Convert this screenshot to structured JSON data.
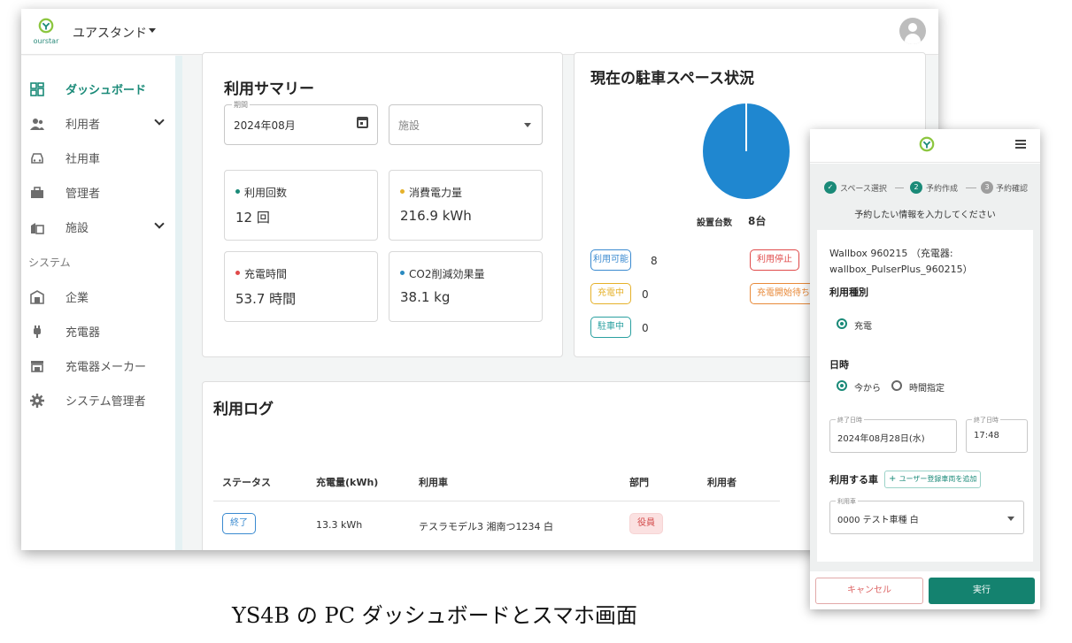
{
  "desktop": {
    "logo_text": "ourstar",
    "org_name": "ユアスタンド",
    "sidebar": {
      "items": [
        {
          "label": "ダッシュボード",
          "icon": "dashboard-icon",
          "active": true
        },
        {
          "label": "利用者",
          "icon": "users-icon",
          "expandable": true
        },
        {
          "label": "社用車",
          "icon": "car-icon"
        },
        {
          "label": "管理者",
          "icon": "briefcase-icon"
        },
        {
          "label": "施設",
          "icon": "facility-icon",
          "expandable": true
        }
      ],
      "section_label": "システム",
      "system_items": [
        {
          "label": "企業",
          "icon": "company-icon"
        },
        {
          "label": "充電器",
          "icon": "plug-icon"
        },
        {
          "label": "充電器メーカー",
          "icon": "store-icon"
        },
        {
          "label": "システム管理者",
          "icon": "gear-icon"
        }
      ]
    },
    "summary": {
      "title": "利用サマリー",
      "period_label": "期間",
      "period_value": "2024年08月",
      "facility_placeholder": "施設",
      "stats": [
        {
          "label": "利用回数",
          "value": "12 回",
          "dot_color": "#1a8a78"
        },
        {
          "label": "消費電力量",
          "value": "216.9 kWh",
          "dot_color": "#e5b12a"
        },
        {
          "label": "充電時間",
          "value": "53.7 時間",
          "dot_color": "#e04a4a"
        },
        {
          "label": "CO2削減効果量",
          "value": "38.1 kg",
          "dot_color": "#2a8ac0"
        }
      ]
    },
    "parking": {
      "title": "現在の駐車スペース状況",
      "pie_color": "#1f87d0",
      "installed_label": "設置台数",
      "installed_value": "8台",
      "statuses": [
        {
          "label": "利用可能",
          "count": "8",
          "color": "#3a8ad0"
        },
        {
          "label": "充電中",
          "count": "0",
          "color": "#e5b12a"
        },
        {
          "label": "駐車中",
          "count": "0",
          "color": "#2aa0a0"
        },
        {
          "label": "利用停止",
          "color": "#e04a4a"
        },
        {
          "label": "充電開始待ち",
          "color": "#e88a3a"
        }
      ]
    },
    "log": {
      "title": "利用ログ",
      "columns": [
        "ステータス",
        "充電量(kWh)",
        "利用車",
        "部門",
        "利用者"
      ],
      "rows": [
        {
          "status": "終了",
          "amount": "13.3 kWh",
          "vehicle": "テスラモデル3 湘南つ1234 白",
          "department": "役員",
          "user": ""
        }
      ]
    }
  },
  "caption": "YS4B の PC ダッシュボードとスマホ画面",
  "mobile": {
    "steps": [
      {
        "num": "✓",
        "label": "スペース選択"
      },
      {
        "num": "2",
        "label": "予約作成"
      },
      {
        "num": "3",
        "label": "予約確認"
      }
    ],
    "subtitle": "予約したい情報を入力してください",
    "charger_line1": "Wallbox 960215 （充電器:",
    "charger_line2": "wallbox_PulserPlus_960215）",
    "usage_type_label": "利用種別",
    "usage_type_option": "充電",
    "datetime_label": "日時",
    "datetime_options": [
      "今から",
      "時間指定"
    ],
    "end_date_label": "終了日時",
    "end_date_value": "2024年08月28日(水)",
    "end_time_label": "終了日時",
    "end_time_value": "17:48",
    "vehicle_label": "利用する車",
    "add_vehicle_button": "ユーザー登録車両を追加",
    "vehicle_field_label": "利用車",
    "vehicle_value": "0000 テスト車種 白",
    "cancel_button": "キャンセル",
    "execute_button": "実行"
  }
}
